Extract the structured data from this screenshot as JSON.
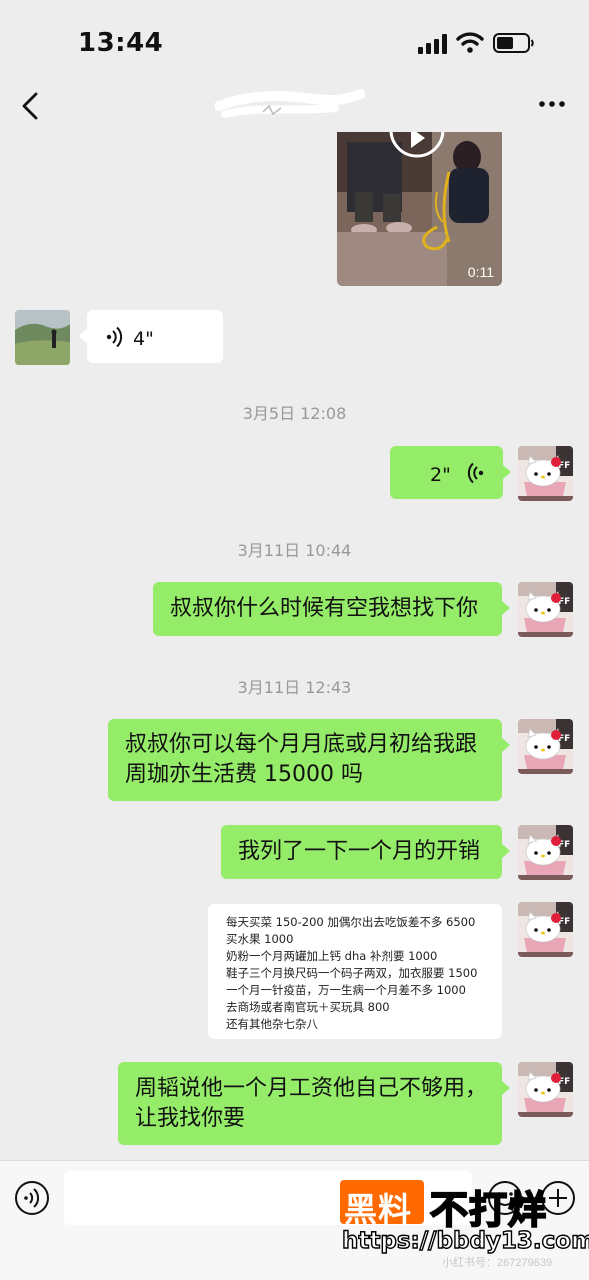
{
  "status_bar": {
    "time": "13:44"
  },
  "nav": {
    "title": ""
  },
  "messages": {
    "video_duration": "0:11",
    "voice_received_duration": "4\"",
    "timestamp_1": "3月5日 12:08",
    "voice_sent_duration": "2\"",
    "timestamp_2": "3月11日 10:44",
    "text_1": "叔叔你什么时候有空我想找下你",
    "timestamp_3": "3月11日 12:43",
    "text_2": "叔叔你可以每个月月底或月初给我跟\n周珈亦生活费 15000 吗",
    "text_3": "我列了一下一个月的开销",
    "expense_list": [
      "每天买菜 150-200 加偶尔出去吃饭差不多 6500",
      "买水果 1000",
      "奶粉一个月两罐加上钙 dha 补剂要 1000",
      "鞋子三个月换尺码一个码子两双，加衣服要 1500",
      "一个月一针疫苗，万一生病一个月差不多 1000",
      "去商场或者南官玩＋买玩具 800",
      "还有其他杂七杂八"
    ],
    "text_4": "周韬说他一个月工资他自己不够用，\n让我找你要"
  },
  "input": {
    "placeholder": ""
  },
  "watermark": {
    "brand_part1": "黑料",
    "brand_part2": "不打烊",
    "url": "https://bbdy13.com",
    "faint_text": "小红书号：267279639"
  },
  "colors": {
    "sent_bubble": "#95ec69",
    "received_bubble": "#ffffff",
    "background": "#ededed",
    "watermark_orange": "#ff6a00"
  },
  "icons": [
    "back-icon",
    "more-icon",
    "play-icon",
    "voice-icon",
    "voice-toggle-icon",
    "emoji-icon",
    "plus-icon",
    "signal-icon",
    "wifi-icon",
    "battery-icon"
  ]
}
